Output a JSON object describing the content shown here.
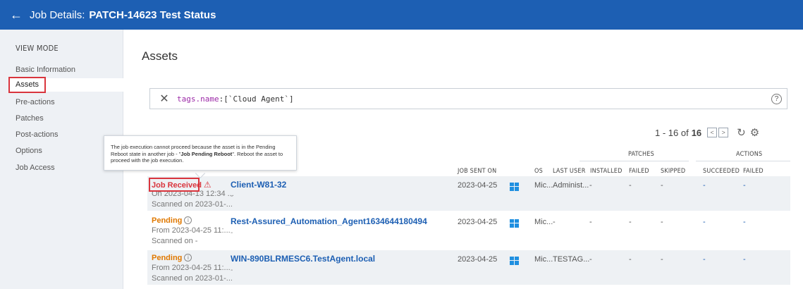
{
  "header": {
    "back_icon": "arrow-left-icon",
    "title_prefix": "Job Details:",
    "title_name": "PATCH-14623 Test Status",
    "color": "#1d5fb3"
  },
  "sidebar": {
    "heading": "VIEW MODE",
    "items": [
      {
        "label": "Basic Information"
      },
      {
        "label": "Assets"
      },
      {
        "label": "Pre-actions"
      },
      {
        "label": "Patches"
      },
      {
        "label": "Post-actions"
      },
      {
        "label": "Options"
      },
      {
        "label": "Job Access"
      }
    ],
    "active_item": "Assets"
  },
  "main": {
    "title": "Assets",
    "search": {
      "query_key": "tags.name",
      "query_value": ":[`Cloud Agent`]",
      "clear_icon": "close-icon",
      "help_icon": "help-icon"
    },
    "pagination": {
      "range": "1 - 16 of",
      "total": "16",
      "prev": "<",
      "next": ">"
    },
    "columns": {
      "job_sent_on": "JOB SENT ON",
      "os": "OS",
      "last_user": "LAST USER",
      "patches_group": "PATCHES",
      "installed": "INSTALLED",
      "failed": "FAILED",
      "skipped": "SKIPPED",
      "actions_group": "ACTIONS",
      "succeeded": "SUCCEEDED",
      "actions_failed": "FAILED"
    },
    "tooltip": {
      "text_before": "The job execution cannot proceed because the asset is in the Pending Reboot state in another job - \"",
      "bold": "Job Pending Reboot",
      "text_after": "\". Reboot the asset to proceed with the job execution."
    },
    "rows": [
      {
        "status": "Job Received",
        "status_icon": "warning-icon",
        "sub1": "On 2023-04-13 12:34 ...",
        "sub2": "Scanned on 2023-01-...",
        "asset": "Client-W81-32",
        "asset_sub": "-",
        "job_sent_on": "2023-04-25",
        "os": "Mic...",
        "last_user": "Administ...",
        "installed": "-",
        "failed": "-",
        "skipped": "-",
        "succeeded": "-",
        "actions_failed": "-"
      },
      {
        "status": "Pending",
        "status_icon": "info-icon",
        "sub1": "From 2023-04-25 11:...",
        "sub2": "Scanned on -",
        "asset": "Rest-Assured_Automation_Agent1634644180494",
        "asset_sub": "-",
        "job_sent_on": "2023-04-25",
        "os": "Mic...",
        "last_user": "-",
        "installed": "-",
        "failed": "-",
        "skipped": "-",
        "succeeded": "-",
        "actions_failed": "-"
      },
      {
        "status": "Pending",
        "status_icon": "info-icon",
        "sub1": "From 2023-04-25 11:...",
        "sub2": "Scanned on 2023-01-...",
        "asset": "WIN-890BLRMESC6.TestAgent.local",
        "asset_sub": "-",
        "job_sent_on": "2023-04-25",
        "os": "Mic...",
        "last_user": "TESTAG...",
        "installed": "-",
        "failed": "-",
        "skipped": "-",
        "succeeded": "-",
        "actions_failed": "-"
      }
    ]
  }
}
